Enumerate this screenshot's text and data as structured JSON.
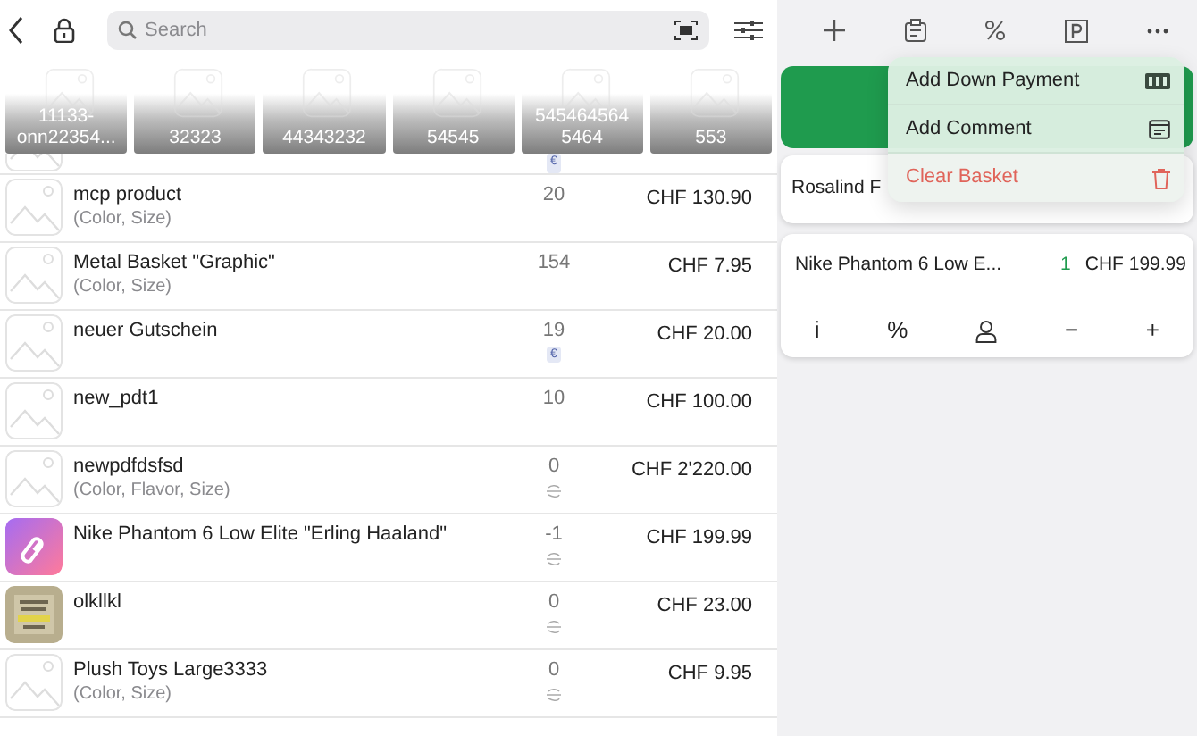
{
  "search": {
    "placeholder": "Search"
  },
  "categories": [
    {
      "lines": [
        "11133-",
        "onn22354..."
      ]
    },
    {
      "lines": [
        "32323"
      ]
    },
    {
      "lines": [
        "44343232"
      ]
    },
    {
      "lines": [
        "54545"
      ]
    },
    {
      "lines": [
        "545464564",
        "5464"
      ]
    },
    {
      "lines": [
        "553"
      ]
    }
  ],
  "partial_row": {
    "kind": "placeholder",
    "badge": "€"
  },
  "products": [
    {
      "kind": "placeholder",
      "name": "mcp product",
      "variants": "(Color, Size)",
      "stock": "20",
      "untracked": false,
      "price": "CHF 130.90"
    },
    {
      "kind": "placeholder",
      "name": "Metal Basket \"Graphic\"",
      "variants": "(Color, Size)",
      "stock": "154",
      "untracked": false,
      "price": "CHF 7.95"
    },
    {
      "kind": "placeholder",
      "name": "neuer Gutschein",
      "stock": "19",
      "badge": "€",
      "untracked": false,
      "price": "CHF 20.00"
    },
    {
      "kind": "placeholder",
      "name": "new_pdt1",
      "stock": "10",
      "untracked": false,
      "price": "CHF 100.00"
    },
    {
      "kind": "placeholder",
      "name": "newpdfdsfsd",
      "variants": "(Color, Flavor, Size)",
      "stock": "0",
      "untracked": true,
      "price": "CHF 2'220.00"
    },
    {
      "kind": "logo",
      "name": "Nike Phantom 6 Low Elite \"Erling Haaland\"",
      "stock": "-1",
      "untracked": true,
      "price": "CHF 199.99"
    },
    {
      "kind": "picture",
      "name": "olkllkl",
      "stock": "0",
      "untracked": true,
      "price": "CHF 23.00"
    },
    {
      "kind": "placeholder",
      "name": "Plush Toys Large3333",
      "variants": "(Color, Size)",
      "stock": "0",
      "untracked": true,
      "price": "CHF 9.95"
    }
  ],
  "menu": [
    {
      "label": "Add Down Payment",
      "kind": "payment",
      "danger": false
    },
    {
      "label": "Add Comment",
      "kind": "comment",
      "danger": false
    },
    {
      "label": "Clear Basket",
      "kind": "trash",
      "danger": true
    }
  ],
  "customer": {
    "name": "Rosalind F"
  },
  "basket": [
    {
      "name": "Nike Phantom 6 Low E...",
      "quantity": "1",
      "price": "CHF 199.99"
    }
  ],
  "basket_actions": [
    {
      "kind": "info",
      "label": "i"
    },
    {
      "kind": "percent",
      "label": "%"
    },
    {
      "kind": "person"
    },
    {
      "kind": "minus",
      "label": "−"
    },
    {
      "kind": "plus",
      "label": "+"
    }
  ]
}
